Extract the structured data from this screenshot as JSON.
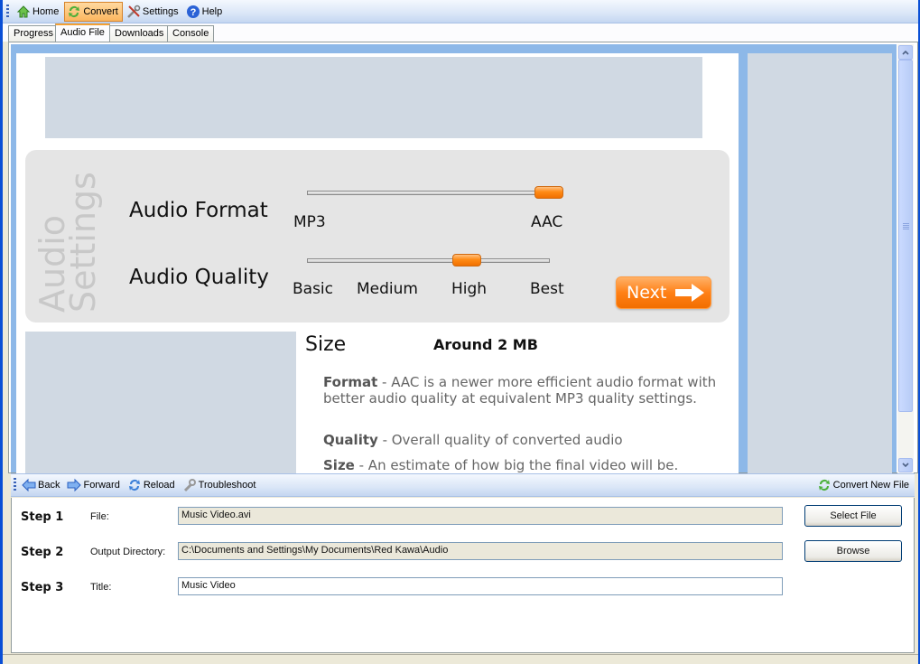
{
  "toolbar": {
    "items": [
      {
        "label": "Home",
        "icon": "home-icon"
      },
      {
        "label": "Convert",
        "icon": "convert-icon",
        "active": true
      },
      {
        "label": "Settings",
        "icon": "settings-icon"
      },
      {
        "label": "Help",
        "icon": "help-icon"
      }
    ]
  },
  "tabs": [
    {
      "label": "Progress"
    },
    {
      "label": "Audio File",
      "active": true
    },
    {
      "label": "Downloads"
    },
    {
      "label": "Console"
    }
  ],
  "settings": {
    "section_title_line1": "Audio",
    "section_title_line2": "Settings",
    "format": {
      "label": "Audio Format",
      "options": [
        "MP3",
        "AAC"
      ],
      "selected": "AAC",
      "value_fraction": 1.0
    },
    "quality": {
      "label": "Audio Quality",
      "options": [
        "Basic",
        "Medium",
        "High",
        "Best"
      ],
      "selected": "High",
      "value_fraction": 0.667
    },
    "next_label": "Next"
  },
  "info": {
    "size_title": "Size",
    "size_value": "Around 2 MB",
    "descriptions": [
      {
        "term": "Format",
        "text": " - AAC is a newer more efficient audio format with better audio quality at equivalent MP3 quality settings."
      },
      {
        "term": "Quality",
        "text": " - Overall quality of converted audio"
      },
      {
        "term": "Size",
        "text": " - An estimate of how big the final video will be."
      }
    ]
  },
  "navbar": {
    "items": [
      {
        "label": "Back",
        "icon": "back-arrow-icon"
      },
      {
        "label": "Forward",
        "icon": "forward-arrow-icon"
      },
      {
        "label": "Reload",
        "icon": "reload-icon"
      },
      {
        "label": "Troubleshoot",
        "icon": "wrench-icon"
      }
    ],
    "right_label": "Convert New File"
  },
  "form": {
    "steps": [
      {
        "step": "Step 1",
        "label": "File:",
        "value": "Music Video.avi",
        "readonly": true,
        "button": "Select File"
      },
      {
        "step": "Step 2",
        "label": "Output Directory:",
        "value": "C:\\Documents and Settings\\My Documents\\Red Kawa\\Audio",
        "readonly": true,
        "button": "Browse"
      },
      {
        "step": "Step 3",
        "label": "Title:",
        "value": "Music Video",
        "readonly": false,
        "button": null
      }
    ]
  },
  "colors": {
    "accent_orange": "#ff8016",
    "frame_blue": "#8db8e8",
    "placeholder_grey": "#d0d9e3"
  }
}
